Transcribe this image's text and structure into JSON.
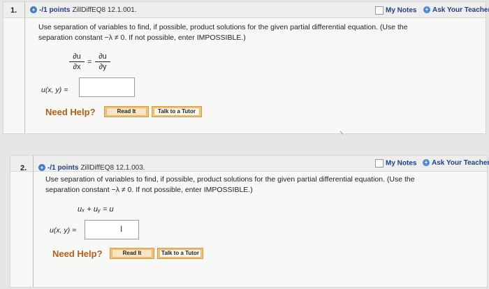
{
  "q1": {
    "number": "1.",
    "points": "-/1 points",
    "source": "ZillDiffEQ8 12.1.001.",
    "my_notes": "My Notes",
    "ask_teacher": "Ask Your Teacher",
    "text_line1": "Use separation of variables to find, if possible, product solutions for the given partial differential equation. (Use the",
    "text_line2": "separation constant −λ ≠ 0.  If not possible, enter IMPOSSIBLE.)",
    "eq_num_left": "∂u",
    "eq_den_left": "∂x",
    "eq_eq": "=",
    "eq_num_right": "∂u",
    "eq_den_right": "∂y",
    "answer_label": "u(x, y) =",
    "answer_value": "",
    "need_help": "Need Help?",
    "read_it": "Read It",
    "talk_tutor": "Talk to a Tutor"
  },
  "q2": {
    "number": "2.",
    "points": "-/1 points",
    "source": "ZillDiffEQ8 12.1.003.",
    "my_notes": "My Notes",
    "ask_teacher": "Ask Your Teacher",
    "text_line1": "Use separation of variables to find, if possible, product solutions for the given partial differential equation. (Use the",
    "text_line2": "separation constant −λ ≠ 0.  If not possible, enter IMPOSSIBLE.)",
    "equation": "uₓ + uᵧ = u",
    "answer_label": "u(x, y) =",
    "answer_value": "",
    "cursor_glyph": "I",
    "need_help": "Need Help?",
    "read_it": "Read It",
    "talk_tutor": "Talk to a Tutor"
  },
  "icons": {
    "plus": "+",
    "ask": "+"
  },
  "colors": {
    "link_blue": "#1f3f88",
    "need_help_orange": "#b85c18",
    "button_orange": "#f3c27a"
  }
}
